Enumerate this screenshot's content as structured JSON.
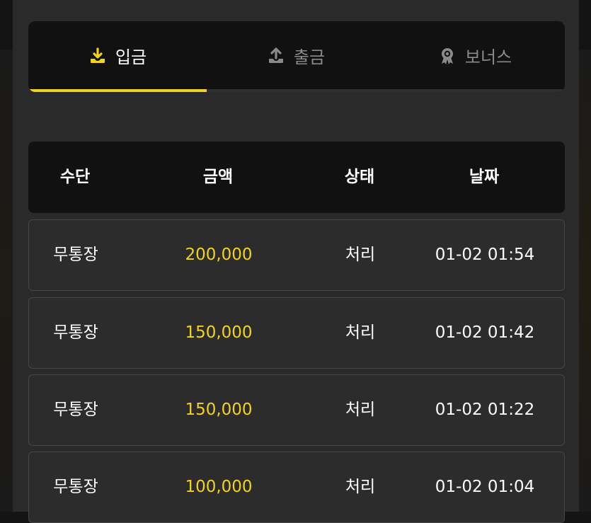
{
  "colors": {
    "accent": "#f2d31b",
    "background": "#2a2a2a",
    "header_bg": "#111111"
  },
  "tabs": [
    {
      "label": "입금",
      "icon": "download-icon",
      "active": true
    },
    {
      "label": "출금",
      "icon": "upload-icon",
      "active": false
    },
    {
      "label": "보너스",
      "icon": "award-icon",
      "active": false
    }
  ],
  "table": {
    "headers": [
      "수단",
      "금액",
      "상태",
      "날짜"
    ],
    "rows": [
      {
        "method": "무통장",
        "amount": "200,000",
        "status": "처리",
        "date": "01-02 01:54"
      },
      {
        "method": "무통장",
        "amount": "150,000",
        "status": "처리",
        "date": "01-02 01:42"
      },
      {
        "method": "무통장",
        "amount": "150,000",
        "status": "처리",
        "date": "01-02 01:22"
      },
      {
        "method": "무통장",
        "amount": "100,000",
        "status": "처리",
        "date": "01-02 01:04"
      }
    ]
  }
}
